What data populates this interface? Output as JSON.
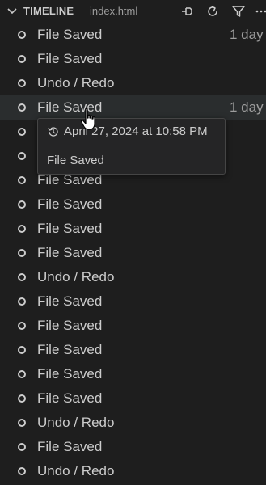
{
  "header": {
    "title": "TIMELINE",
    "subtitle": "index.html",
    "icons": [
      "chevron-down-icon",
      "pin-icon",
      "refresh-icon",
      "filter-icon",
      "more-icon"
    ]
  },
  "items": [
    {
      "label": "File Saved",
      "desc": "1 day"
    },
    {
      "label": "File Saved",
      "desc": ""
    },
    {
      "label": "Undo / Redo",
      "desc": ""
    },
    {
      "label": "File Saved",
      "desc": "1 day"
    },
    {
      "label": "File Saved",
      "desc": ""
    },
    {
      "label": "File Saved",
      "desc": ""
    },
    {
      "label": "File Saved",
      "desc": ""
    },
    {
      "label": "File Saved",
      "desc": ""
    },
    {
      "label": "File Saved",
      "desc": ""
    },
    {
      "label": "File Saved",
      "desc": ""
    },
    {
      "label": "Undo / Redo",
      "desc": ""
    },
    {
      "label": "File Saved",
      "desc": ""
    },
    {
      "label": "File Saved",
      "desc": ""
    },
    {
      "label": "File Saved",
      "desc": ""
    },
    {
      "label": "File Saved",
      "desc": ""
    },
    {
      "label": "File Saved",
      "desc": ""
    },
    {
      "label": "Undo / Redo",
      "desc": ""
    },
    {
      "label": "File Saved",
      "desc": ""
    },
    {
      "label": "Undo / Redo",
      "desc": ""
    }
  ],
  "hovered_index": 3,
  "tooltip": {
    "date": "April 27, 2024 at 10:58 PM",
    "text": "File Saved",
    "icon": "history-icon"
  },
  "colors": {
    "background": "#1e1e1e",
    "hover_row": "#2a2d2e",
    "text": "#cccccc",
    "muted": "#9d9d9d",
    "tooltip_bg": "#252526",
    "tooltip_border": "#454545"
  }
}
